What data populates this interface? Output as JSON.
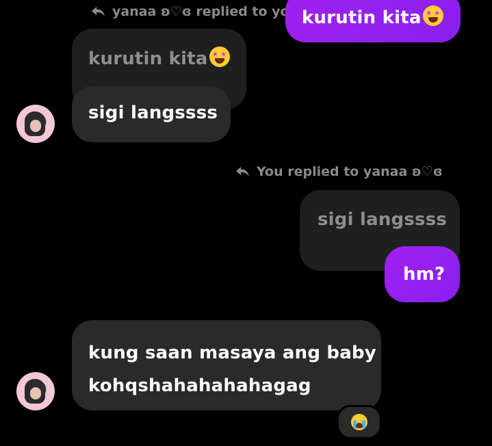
{
  "thread": {
    "reply_note_1": "yanaa ʚ♡ɞ replied to you",
    "reply_note_2": "You replied to yanaa ʚ♡ɞ",
    "msg_outgoing_1": "kurutin kita",
    "msg_quoted_1": "kurutin kita",
    "msg_incoming_1": "sigi langssss",
    "msg_quoted_2": "sigi langssss",
    "msg_outgoing_2": "hm?",
    "msg_incoming_2_line1": "kung saan masaya ang baby",
    "msg_incoming_2_line2": "kohqshahahahahagag"
  },
  "icons": {
    "reply": "reply-arrow-icon",
    "star_eyes": "star-struck-emoji-icon",
    "reaction": "loudly-crying-emoji-icon",
    "avatar": "contact-avatar"
  },
  "colors": {
    "background": "#000000",
    "incoming_bubble": "#2a2a2a",
    "quoted_bubble": "#1f1f1f",
    "outgoing_bubble": "#9a21ef",
    "muted_text": "#8a8a8a"
  }
}
